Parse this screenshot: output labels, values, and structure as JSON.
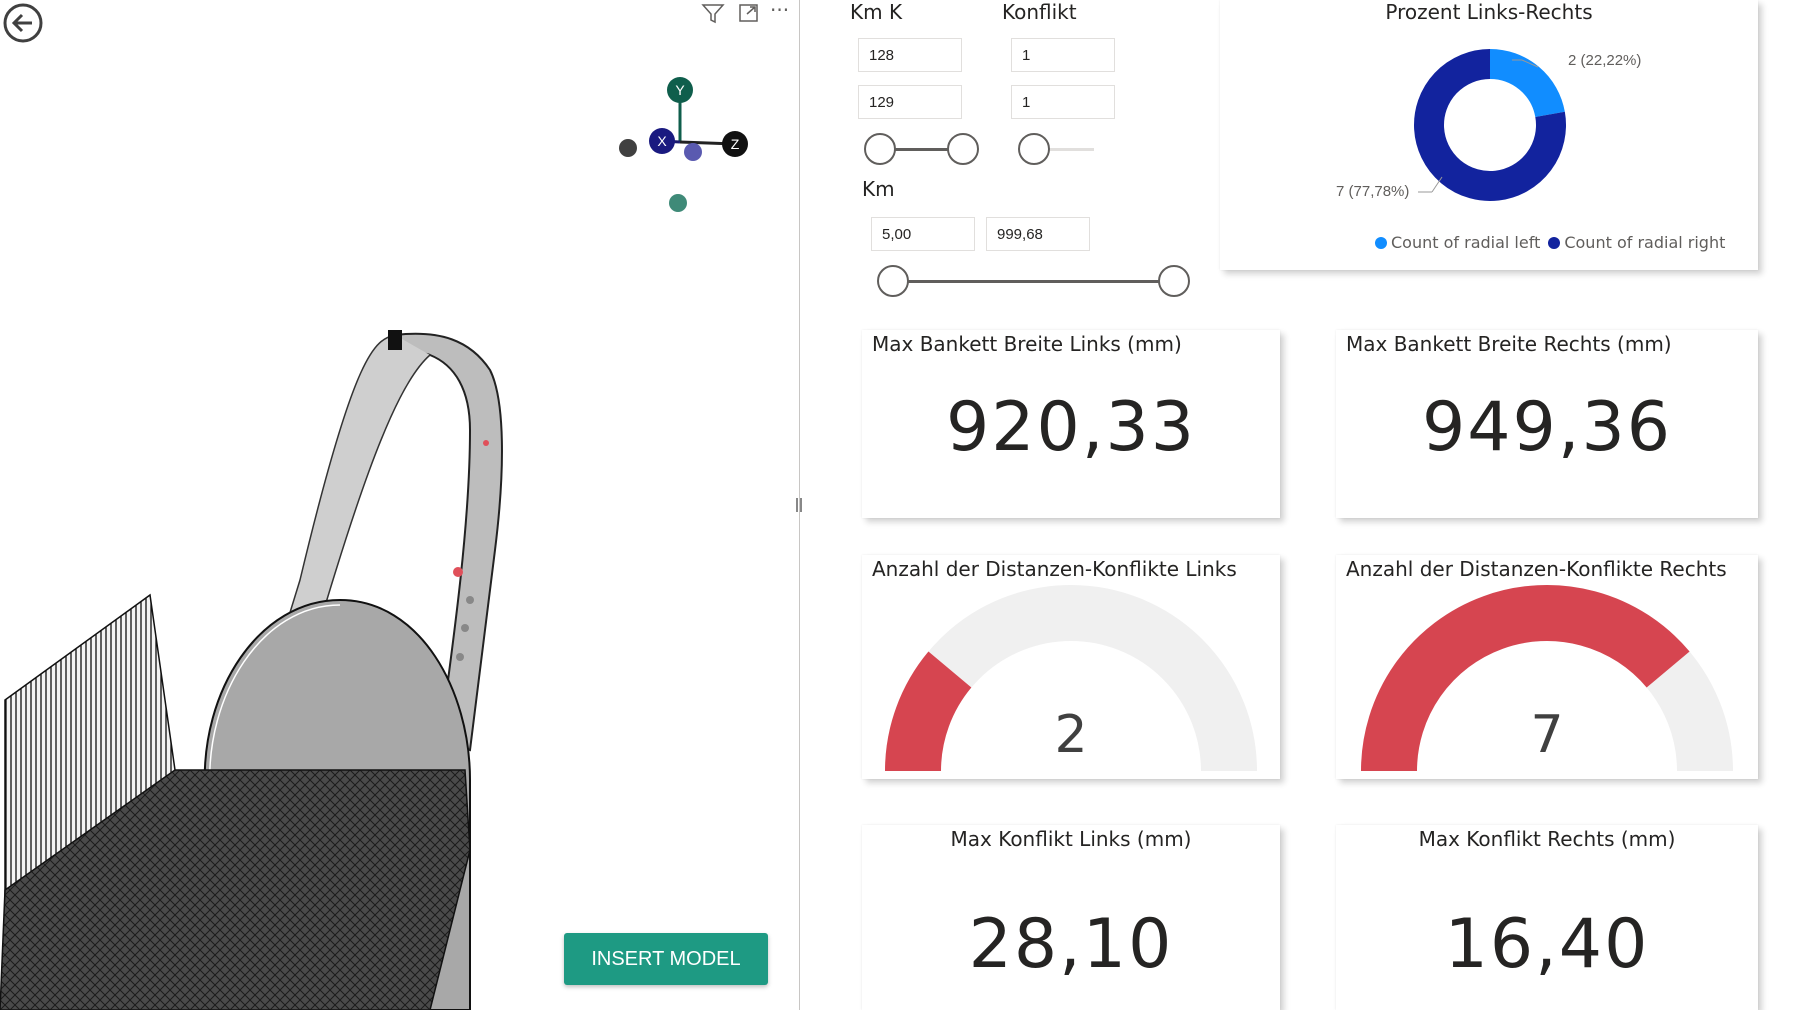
{
  "viewer": {
    "insert_button": "INSERT MODEL",
    "axes": {
      "y": "Y",
      "x": "X",
      "z": "Z"
    },
    "icons": {
      "back": "back-arrow-icon",
      "filter": "filter-icon",
      "focus": "focus-mode-icon",
      "more": "more-options-icon"
    },
    "header_more": "···"
  },
  "slicers": {
    "km_k": {
      "title": "Km K",
      "min": "128",
      "max": "129"
    },
    "konflikt": {
      "title": "Konflikt",
      "min": "1",
      "max": "1"
    },
    "km": {
      "title": "Km",
      "min": "5,00",
      "max": "999,68"
    }
  },
  "donut": {
    "title": "Prozent Links-Rechts",
    "slices": [
      {
        "label": "2 (22,22%)",
        "value": 2,
        "percent": 22.22,
        "color": "#118DFF"
      },
      {
        "label": "7 (77,78%)",
        "value": 7,
        "percent": 77.78,
        "color": "#12239E"
      }
    ],
    "legend": [
      {
        "name": "Count of radial left",
        "color": "#118DFF"
      },
      {
        "name": "Count of radial right",
        "color": "#12239E"
      }
    ]
  },
  "cards": {
    "bankett_links": {
      "title": "Max Bankett Breite Links (mm)",
      "value": "920,33"
    },
    "bankett_rechts": {
      "title": "Max Bankett Breite Rechts (mm)",
      "value": "949,36"
    },
    "konflikt_links": {
      "title": "Max Konflikt Links (mm)",
      "value": "28,10"
    },
    "konflikt_rechts": {
      "title": "Max Konflikt Rechts (mm)",
      "value": "16,40"
    }
  },
  "gauges": {
    "links": {
      "title": "Anzahl der Distanzen-Konflikte Links",
      "value": "2",
      "fraction": 0.222,
      "color": "#D64550",
      "track": "#F0F0F0"
    },
    "rechts": {
      "title": "Anzahl der Distanzen-Konflikte Rechts",
      "value": "7",
      "fraction": 0.778,
      "color": "#D64550",
      "track": "#F0F0F0"
    }
  }
}
